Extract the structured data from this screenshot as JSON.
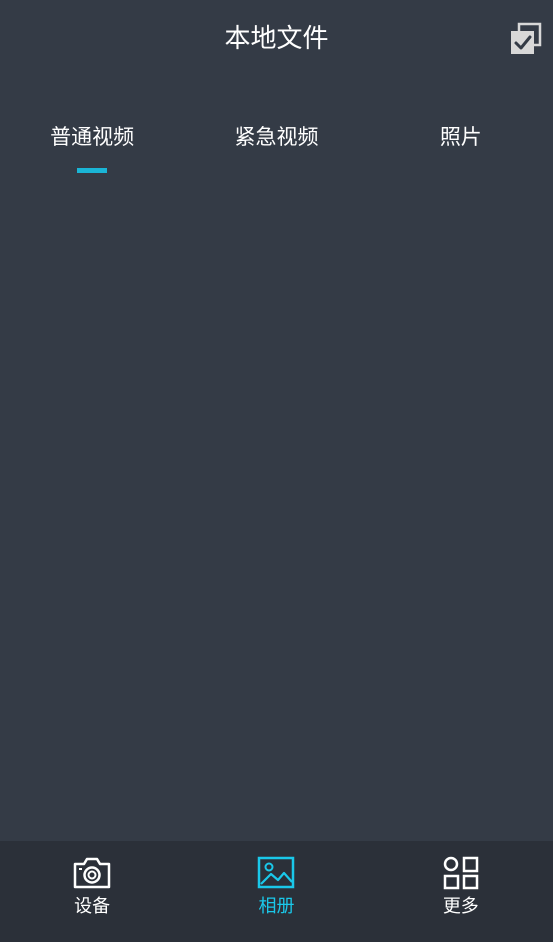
{
  "header": {
    "title": "本地文件",
    "select_icon": "checkbox-copy-icon"
  },
  "tabs": [
    {
      "label": "普通视频",
      "active": true
    },
    {
      "label": "紧急视频",
      "active": false
    },
    {
      "label": "照片",
      "active": false
    }
  ],
  "bottom_nav": [
    {
      "label": "设备",
      "icon": "camera-icon",
      "active": false
    },
    {
      "label": "相册",
      "icon": "image-icon",
      "active": true
    },
    {
      "label": "更多",
      "icon": "grid-icon",
      "active": false
    }
  ],
  "colors": {
    "background": "#343b46",
    "nav_background": "#2b3039",
    "accent": "#1ab5d6",
    "text": "#ffffff"
  }
}
